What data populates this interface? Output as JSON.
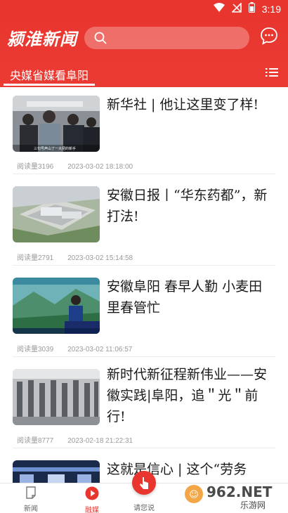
{
  "status_bar": {
    "time": "3:19"
  },
  "app": {
    "logo": "颍淮新闻",
    "search_placeholder": ""
  },
  "channel_tab": "央媒省媒看阜阳",
  "feed": [
    {
      "title": "新华社 | 他让这里变了样!",
      "reads": "阅读量3196",
      "time": "2023-03-02 18:18:00",
      "thumb_caption": "三句号声山了一大把的新手"
    },
    {
      "title": "安徽日报丨“华东药都”，新打法!",
      "reads": "阅读量2791",
      "time": "2023-03-02 15:14:58"
    },
    {
      "title": "安徽阜阳 春早人勤 小麦田里春管忙",
      "reads": "阅读量3039",
      "time": "2023-03-02 11:06:57"
    },
    {
      "title": "新时代新征程新伟业——安徽实践|阜阳，追＂光＂前行!",
      "reads": "阅读量8777",
      "time": "2023-02-18 21:22:31"
    },
    {
      "title": "这就是信心 | 这个“劳务",
      "reads": "",
      "time": ""
    }
  ],
  "bottom_nav": {
    "news": "新闻",
    "live": "融媒",
    "say": "请您说"
  },
  "watermark": {
    "brand": "962.NET",
    "sub": "乐游网"
  },
  "colors": {
    "brand_red": "#e8352e",
    "text": "#1a1a1a",
    "meta": "#9a9a9a"
  }
}
